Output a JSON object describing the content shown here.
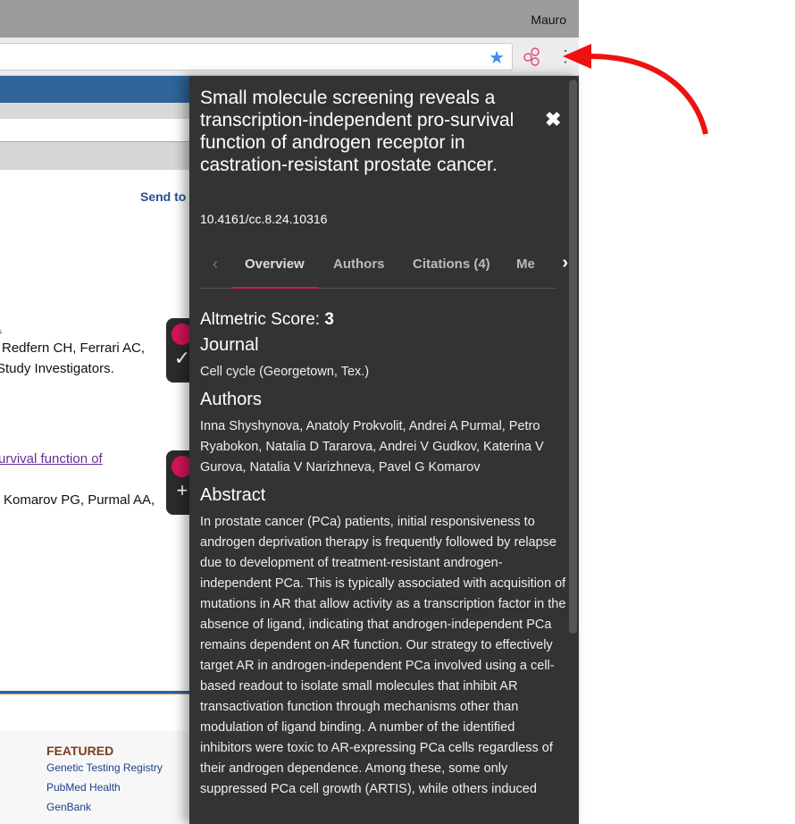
{
  "browser": {
    "user": "Mauro"
  },
  "page": {
    "send_to": "Send to",
    "result1": {
      "link_fragment": "",
      "authors_fragment": "Redfern CH, Ferrari AC,",
      "group_fragment": "Study Investigators.",
      "badge": "✓"
    },
    "result2": {
      "link_fragment": "urvival function of",
      "authors_fragment": "Komarov PG, Purmal AA,",
      "badge": "+"
    },
    "featured": {
      "heading": "FEATURED",
      "links": [
        "Genetic Testing Registry",
        "PubMed Health",
        "GenBank"
      ]
    }
  },
  "panel": {
    "title": "Small molecule screening reveals a transcription-independent pro-survival function of androgen receptor in castration-resistant prostate cancer.",
    "close": "✖",
    "doi": "10.4161/cc.8.24.10316",
    "tabs": [
      "Overview",
      "Authors",
      "Citations (4)",
      "Me"
    ],
    "active_tab": "Overview",
    "score_label": "Altmetric Score:",
    "score": "3",
    "journal_heading": "Journal",
    "journal": "Cell cycle (Georgetown, Tex.)",
    "authors_heading": "Authors",
    "authors": "Inna Shyshynova, Anatoly Prokvolit, Andrei A Purmal, Petro Ryabokon, Natalia D Tararova, Andrei V Gudkov, Katerina V Gurova, Natalia V Narizhneva, Pavel G Komarov",
    "abstract_heading": "Abstract",
    "abstract": "In prostate cancer (PCa) patients, initial responsiveness to androgen deprivation therapy is frequently followed by relapse due to development of treatment-resistant androgen-independent PCa. This is typically associated with acquisition of mutations in AR that allow activity as a transcription factor in the absence of ligand, indicating that androgen-independent PCa remains dependent on AR function. Our strategy to effectively target AR in androgen-independent PCa involved using a cell-based readout to isolate small molecules that inhibit AR transactivation function through mechanisms other than modulation of ligand binding. A number of the identified inhibitors were toxic to AR-expressing PCa cells regardless of their androgen dependence. Among these, some only suppressed PCa cell growth (ARTIS), while others induced"
  },
  "colors": {
    "accent": "#d4145a",
    "panel_bg": "#333333",
    "nav_blue": "#2f6399",
    "annotation_arrow": "#ee1111"
  }
}
